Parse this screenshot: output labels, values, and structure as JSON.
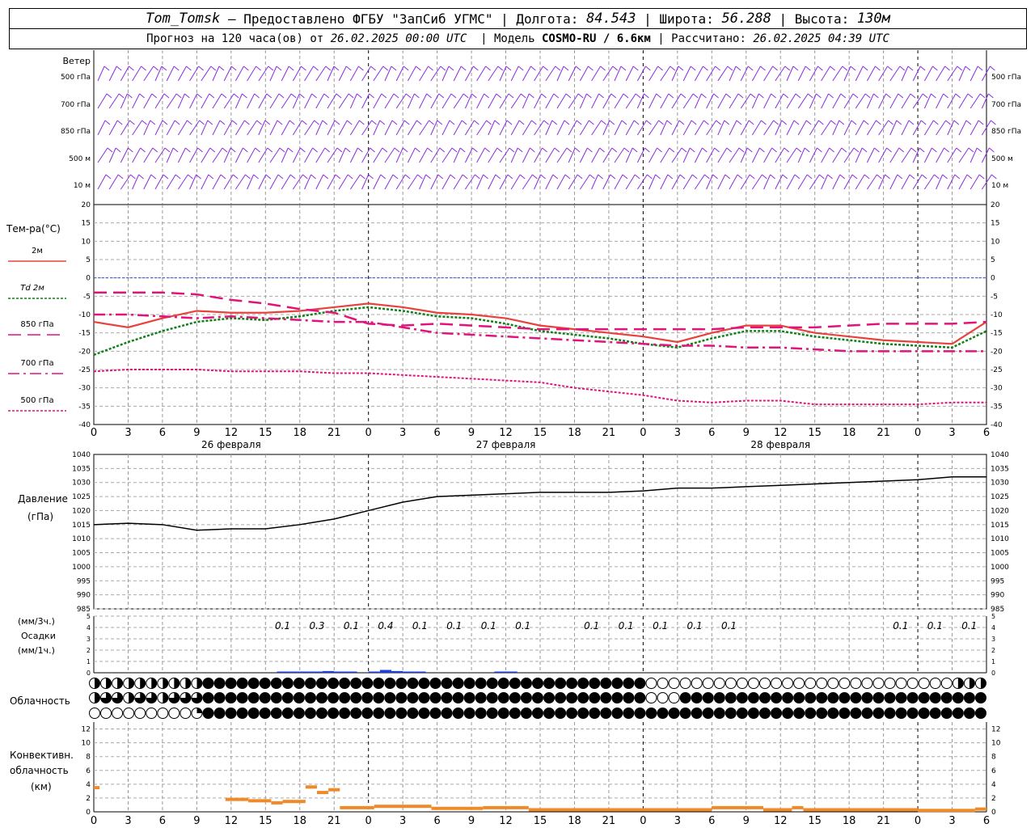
{
  "header": {
    "station": "Tom_Tomsk",
    "provider": "– Предоставлено ФГБУ \"ЗапСиб УГМС\"",
    "lon_label": "Долгота:",
    "lon_value": "84.543",
    "lat_label": "Широта:",
    "lat_value": "56.288",
    "alt_label": "Высота:",
    "alt_value": "130м",
    "forecast_prefix": "Прогноз на 120 часа(ов) от",
    "forecast_start": "26.02.2025 00:00 UTC",
    "model_label": "Модель",
    "model_value": "COSMO-RU / 6.6км",
    "computed_label": "Рассчитано:",
    "computed_value": "26.02.2025 04:39 UTC"
  },
  "colors": {
    "t2m": "#e8423c",
    "td2m": "#12801a",
    "t850": "#e0147a",
    "t700": "#e0147a",
    "t500": "#e0147a",
    "wind": "#8a2be2",
    "pressure": "#000000",
    "precip": "#1f3fd8",
    "convective": "#f08a28",
    "zero_line": "#3050e0"
  },
  "chart_data": [
    {
      "type": "wind_barbs",
      "label": "Ветер",
      "levels": [
        "500 гПа",
        "700 гПа",
        "850 гПа",
        "500 м",
        "10 м"
      ]
    },
    {
      "type": "line",
      "label": "Тем-ра(°C)",
      "x_ticks": [
        "0",
        "3",
        "6",
        "9",
        "12",
        "15",
        "18",
        "21",
        "0",
        "3",
        "6",
        "9",
        "12",
        "15",
        "18",
        "21",
        "0",
        "3",
        "6",
        "9",
        "12",
        "15",
        "18",
        "21",
        "0",
        "3",
        "6"
      ],
      "date_labels": [
        "26 февраля",
        "27 февраля",
        "28 февраля"
      ],
      "y_ticks": [
        20,
        15,
        10,
        5,
        0,
        -5,
        -10,
        -15,
        -20,
        -25,
        -30,
        -35,
        -40
      ],
      "ylim": [
        -40,
        20
      ],
      "x_hours": [
        0,
        3,
        6,
        9,
        12,
        15,
        18,
        21,
        24,
        27,
        30,
        33,
        36,
        39,
        42,
        45,
        48,
        51,
        54,
        57,
        60,
        63,
        66,
        69,
        72,
        75,
        78
      ],
      "series": [
        {
          "name": "2м",
          "values": [
            -12,
            -13.5,
            -11,
            -9,
            -9.5,
            -9.5,
            -9,
            -8,
            -7,
            -8,
            -9.5,
            -10,
            -11,
            -13,
            -14,
            -15,
            -16,
            -17.5,
            -15,
            -13,
            -13,
            -15,
            -16,
            -17,
            -17.5,
            -18,
            -12
          ]
        },
        {
          "name": "Td 2м",
          "values": [
            -21,
            -17.5,
            -14.5,
            -12,
            -11,
            -11.5,
            -10.5,
            -9,
            -8,
            -9,
            -10.5,
            -11,
            -12.5,
            -14.5,
            -15.5,
            -16.5,
            -18,
            -19,
            -16.5,
            -14.5,
            -14.5,
            -16,
            -17,
            -18,
            -18.5,
            -19,
            -14.5
          ]
        },
        {
          "name": "850 гПа",
          "values": [
            -4,
            -4,
            -4,
            -4.5,
            -6,
            -7,
            -8.5,
            -9.5,
            -12.5,
            -13,
            -12.5,
            -13,
            -13.5,
            -14,
            -14,
            -14,
            -14,
            -14,
            -14,
            -13.5,
            -13.5,
            -13.5,
            -13,
            -12.5,
            -12.5,
            -12.5,
            -12
          ]
        },
        {
          "name": "700 гПа",
          "values": [
            -10,
            -10,
            -10.5,
            -11,
            -10.5,
            -11,
            -11.5,
            -12,
            -12,
            -13.5,
            -15,
            -15.5,
            -16,
            -16.5,
            -17,
            -17.5,
            -18,
            -18.5,
            -18.5,
            -19,
            -19,
            -19.5,
            -20,
            -20,
            -20,
            -20,
            -20
          ]
        },
        {
          "name": "500 гПа",
          "values": [
            -25.5,
            -25,
            -25,
            -25,
            -25.5,
            -25.5,
            -25.5,
            -26,
            -26,
            -26.5,
            -27,
            -27.5,
            -28,
            -28.5,
            -30,
            -31,
            -32,
            -33.5,
            -34,
            -33.5,
            -33.5,
            -34.5,
            -34.5,
            -34.5,
            -34.5,
            -34,
            -34
          ]
        }
      ]
    },
    {
      "type": "line",
      "label": "Давление",
      "unit": "(гПа)",
      "y_ticks": [
        1040,
        1035,
        1030,
        1025,
        1020,
        1015,
        1010,
        1005,
        1000,
        995,
        990,
        985
      ],
      "ylim": [
        985,
        1040
      ],
      "x_hours": [
        0,
        3,
        6,
        9,
        12,
        15,
        18,
        21,
        24,
        27,
        30,
        33,
        36,
        39,
        42,
        45,
        48,
        51,
        54,
        57,
        60,
        63,
        66,
        69,
        72,
        75,
        78
      ],
      "values": [
        1015,
        1015.5,
        1015,
        1013,
        1013.5,
        1013.5,
        1015,
        1017,
        1020,
        1023,
        1025,
        1025.5,
        1026,
        1026.5,
        1026.5,
        1026.5,
        1027,
        1028,
        1028,
        1028.5,
        1029,
        1029.5,
        1030,
        1030.5,
        1031,
        1032,
        1032
      ]
    },
    {
      "type": "bar",
      "label": "Осадки",
      "unit_top": "(мм/3ч.)",
      "unit_bottom": "(мм/1ч.)",
      "y_ticks": [
        5,
        4,
        3,
        2,
        1,
        0
      ],
      "ylim": [
        0,
        5
      ],
      "labels_3h": [
        {
          "hour": 16.5,
          "value": "0.1"
        },
        {
          "hour": 19.5,
          "value": "0.3"
        },
        {
          "hour": 22.5,
          "value": "0.1"
        },
        {
          "hour": 25.5,
          "value": "0.4"
        },
        {
          "hour": 28.5,
          "value": "0.1"
        },
        {
          "hour": 31.5,
          "value": "0.1"
        },
        {
          "hour": 34.5,
          "value": "0.1"
        },
        {
          "hour": 37.5,
          "value": "0.1"
        },
        {
          "hour": 43.5,
          "value": "0.1"
        },
        {
          "hour": 46.5,
          "value": "0.1"
        },
        {
          "hour": 49.5,
          "value": "0.1"
        },
        {
          "hour": 52.5,
          "value": "0.1"
        },
        {
          "hour": 55.5,
          "value": "0.1"
        },
        {
          "hour": 70.5,
          "value": "0.1"
        },
        {
          "hour": 73.5,
          "value": "0.1"
        },
        {
          "hour": 76.5,
          "value": "0.1"
        }
      ],
      "hourly": [
        {
          "hour": 16,
          "value": 0.1
        },
        {
          "hour": 17,
          "value": 0.1
        },
        {
          "hour": 18,
          "value": 0.1
        },
        {
          "hour": 19,
          "value": 0.1
        },
        {
          "hour": 20,
          "value": 0.15
        },
        {
          "hour": 21,
          "value": 0.1
        },
        {
          "hour": 22,
          "value": 0.05
        },
        {
          "hour": 24,
          "value": 0.1
        },
        {
          "hour": 25,
          "value": 0.25
        },
        {
          "hour": 26,
          "value": 0.15
        },
        {
          "hour": 27,
          "value": 0.05
        },
        {
          "hour": 28,
          "value": 0.05
        },
        {
          "hour": 35,
          "value": 0.05
        },
        {
          "hour": 36,
          "value": 0.1
        }
      ]
    },
    {
      "type": "cloud_cover",
      "label": "Облачность",
      "rows": 3,
      "oktas": [
        [
          4,
          4,
          4,
          4,
          4,
          4,
          4,
          4,
          4,
          4,
          8,
          8,
          8,
          8,
          8,
          8,
          8,
          8,
          8,
          8,
          8,
          8,
          8,
          8,
          8,
          8,
          8,
          8,
          8,
          8,
          8,
          8,
          8,
          8,
          8,
          8,
          8,
          8,
          8,
          8,
          8,
          8,
          8,
          8,
          8,
          8,
          8,
          8,
          8,
          0,
          0,
          0,
          0,
          0,
          0,
          0,
          0,
          0,
          0,
          0,
          0,
          0,
          0,
          0,
          0,
          0,
          0,
          0,
          0,
          0,
          0,
          0,
          0,
          0,
          0,
          0,
          4,
          4,
          4
        ],
        [
          4,
          6,
          6,
          4,
          6,
          6,
          4,
          6,
          6,
          6,
          8,
          8,
          8,
          8,
          8,
          8,
          8,
          8,
          8,
          8,
          8,
          8,
          8,
          8,
          8,
          8,
          8,
          8,
          8,
          8,
          8,
          8,
          8,
          8,
          8,
          8,
          8,
          8,
          8,
          8,
          8,
          8,
          8,
          8,
          8,
          8,
          8,
          8,
          8,
          0,
          0,
          0,
          8,
          8,
          8,
          8,
          8,
          8,
          8,
          8,
          8,
          8,
          8,
          8,
          8,
          8,
          8,
          8,
          8,
          8,
          8,
          8,
          8,
          8,
          8,
          8,
          8,
          8,
          8
        ],
        [
          0,
          0,
          0,
          0,
          0,
          0,
          0,
          0,
          0,
          2,
          8,
          8,
          8,
          8,
          8,
          8,
          8,
          8,
          8,
          8,
          8,
          8,
          8,
          8,
          8,
          8,
          8,
          8,
          8,
          8,
          8,
          8,
          8,
          8,
          8,
          8,
          8,
          8,
          8,
          8,
          8,
          8,
          8,
          8,
          8,
          8,
          8,
          8,
          8,
          8,
          8,
          8,
          8,
          8,
          8,
          8,
          8,
          8,
          8,
          8,
          8,
          8,
          8,
          8,
          8,
          8,
          8,
          8,
          8,
          8,
          8,
          8,
          8,
          8,
          8,
          8,
          8,
          8,
          8
        ]
      ]
    },
    {
      "type": "bar",
      "label": "Конвективн.",
      "label2": "облачность",
      "unit": "(км)",
      "x_ticks": [
        "0",
        "3",
        "6",
        "9",
        "12",
        "15",
        "18",
        "21",
        "0",
        "3",
        "6",
        "9",
        "12",
        "15",
        "18",
        "21",
        "0",
        "3",
        "6",
        "9",
        "12",
        "15",
        "18",
        "21",
        "0",
        "3",
        "6"
      ],
      "y_ticks": [
        12,
        10,
        8,
        6,
        4,
        2,
        0
      ],
      "ylim": [
        0,
        13
      ],
      "segments": [
        {
          "start": 0,
          "end": 0.5,
          "value": 3.5
        },
        {
          "start": 11.5,
          "end": 13.5,
          "value": 1.8
        },
        {
          "start": 13.5,
          "end": 15.5,
          "value": 1.6
        },
        {
          "start": 15.5,
          "end": 16.5,
          "value": 1.3
        },
        {
          "start": 16.5,
          "end": 18.5,
          "value": 1.5
        },
        {
          "start": 18.5,
          "end": 19.5,
          "value": 3.6
        },
        {
          "start": 19.5,
          "end": 20.5,
          "value": 2.8
        },
        {
          "start": 20.5,
          "end": 21.5,
          "value": 3.2
        },
        {
          "start": 21.5,
          "end": 24.5,
          "value": 0.6
        },
        {
          "start": 24.5,
          "end": 29.5,
          "value": 0.8
        },
        {
          "start": 29.5,
          "end": 34,
          "value": 0.5
        },
        {
          "start": 34,
          "end": 38,
          "value": 0.6
        },
        {
          "start": 38,
          "end": 54,
          "value": 0.3
        },
        {
          "start": 54,
          "end": 58.5,
          "value": 0.6
        },
        {
          "start": 58.5,
          "end": 61,
          "value": 0.3
        },
        {
          "start": 61,
          "end": 62,
          "value": 0.6
        },
        {
          "start": 62,
          "end": 72,
          "value": 0.3
        },
        {
          "start": 72,
          "end": 77,
          "value": 0.2
        },
        {
          "start": 77,
          "end": 78,
          "value": 0.4
        }
      ]
    }
  ]
}
